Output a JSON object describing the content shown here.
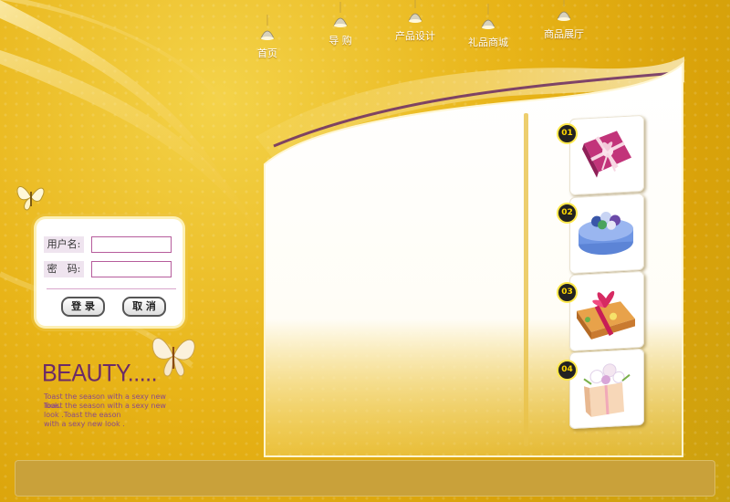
{
  "nav": {
    "items": [
      {
        "label": "首页"
      },
      {
        "label": "导 购"
      },
      {
        "label": "产品设计"
      },
      {
        "label": "礼品商城"
      },
      {
        "label": "商品展厅"
      }
    ]
  },
  "login": {
    "username_label": "用户名:",
    "password_label": "密　码:",
    "username_value": "",
    "password_value": "",
    "login_button": "登 录",
    "cancel_button": "取 消"
  },
  "beauty": {
    "title": "BEAUTY.....",
    "lines": [
      "Toast the season with a sexy new look.",
      "Toast the season with a sexy new",
      "look .Toast the eason",
      "with a sexy new look ."
    ]
  },
  "products": [
    {
      "number": "01",
      "icon": "gift-box-icon"
    },
    {
      "number": "02",
      "icon": "flower-tin-icon"
    },
    {
      "number": "03",
      "icon": "candy-box-icon"
    },
    {
      "number": "04",
      "icon": "flower-gift-box-icon"
    }
  ],
  "colors": {
    "background": "#e8b418",
    "accent_purple": "#6b2a68",
    "footer": "#c9a13a"
  }
}
